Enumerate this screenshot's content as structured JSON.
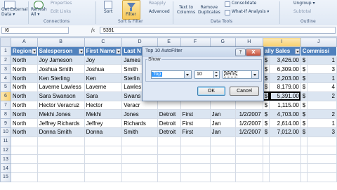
{
  "ribbon": {
    "buttons": {
      "from_external": [
        "Get External",
        "Data ▾"
      ],
      "refresh": [
        "Refresh",
        "All ▾"
      ],
      "properties": "Properties",
      "edit_links": "Edit Links",
      "sort": "Sort",
      "filter": "Filter",
      "reapply": "Reapply",
      "advanced": "Advanced",
      "text_to_columns": [
        "Text to",
        "Columns"
      ],
      "remove_duplicates": [
        "Remove",
        "Duplicates"
      ],
      "consolidate": "Consolidate",
      "what_if": "What-If Analysis ▾",
      "ungroup": "Ungroup ▾",
      "subtotal": "Subtotal"
    },
    "groups": {
      "connections": "Connections",
      "sort_filter": "Sort & Filter",
      "data_tools": "Data Tools",
      "outline": "Outline"
    }
  },
  "formula_bar": {
    "name_box": "I6",
    "fx": "fx",
    "value": "5391"
  },
  "grid": {
    "columns": [
      "A",
      "B",
      "C",
      "D",
      "E",
      "F",
      "G",
      "H",
      "I",
      "J"
    ],
    "selected_column": "I",
    "selected_row": "6",
    "header": [
      "Region",
      "Salesperson",
      "First Name",
      "Last N",
      "",
      "",
      "",
      "",
      "ally Sales",
      "Commissi"
    ],
    "rows": [
      {
        "n": "2",
        "cells": [
          "North",
          "Joy Jameson",
          "Joy",
          "James",
          "",
          "",
          "",
          "",
          "$",
          "3,426.00",
          "$",
          "1"
        ]
      },
      {
        "n": "3",
        "cells": [
          "North",
          "Joshua Smith",
          "Joshua",
          "Smith",
          "",
          "",
          "",
          "",
          "$",
          "6,309.00",
          "$",
          "3"
        ]
      },
      {
        "n": "4",
        "cells": [
          "North",
          "Ken Sterling",
          "Ken",
          "Sterlin",
          "",
          "",
          "",
          "",
          "$",
          "2,203.00",
          "$",
          "1"
        ]
      },
      {
        "n": "5",
        "cells": [
          "North",
          "Laverne Lawless",
          "Laverne",
          "Lawles",
          "",
          "",
          "",
          "",
          "$",
          "8,179.00",
          "$",
          "4"
        ]
      },
      {
        "n": "6",
        "cells": [
          "North",
          "Sara Swanson",
          "Sara",
          "Swans",
          "",
          "",
          "",
          "",
          "$",
          "5,391.00",
          "$",
          "2"
        ]
      },
      {
        "n": "7",
        "cells": [
          "North",
          "Hector Veracruz",
          "Hector",
          "Veracr",
          "",
          "",
          "",
          "",
          "$",
          "1,115.00",
          "$",
          ""
        ]
      },
      {
        "n": "8",
        "cells": [
          "North",
          "Mekhi Jones",
          "Mekhi",
          "Jones",
          "Detroit",
          "First",
          "Jan",
          "1/2/2007",
          "$",
          "4,703.00",
          "$",
          "2"
        ]
      },
      {
        "n": "9",
        "cells": [
          "North",
          "Jeffrey Richards",
          "Jeffrey",
          "Richards",
          "Detroit",
          "First",
          "Jan",
          "1/2/2007",
          "$",
          "2,614.00",
          "$",
          "1"
        ]
      },
      {
        "n": "10",
        "cells": [
          "North",
          "Donna Smith",
          "Donna",
          "Smith",
          "Detroit",
          "First",
          "Jan",
          "1/2/2007",
          "$",
          "7,012.00",
          "$",
          "3"
        ]
      },
      {
        "n": "11",
        "cells": [
          "",
          "",
          "",
          "",
          "",
          "",
          "",
          "",
          "",
          "",
          "",
          ""
        ]
      },
      {
        "n": "12",
        "cells": [
          "",
          "",
          "",
          "",
          "",
          "",
          "",
          "",
          "",
          "",
          "",
          ""
        ]
      },
      {
        "n": "13",
        "cells": [
          "",
          "",
          "",
          "",
          "",
          "",
          "",
          "",
          "",
          "",
          "",
          ""
        ]
      },
      {
        "n": "14",
        "cells": [
          "",
          "",
          "",
          "",
          "",
          "",
          "",
          "",
          "",
          "",
          "",
          ""
        ]
      },
      {
        "n": "15",
        "cells": [
          "",
          "",
          "",
          "",
          "",
          "",
          "",
          "",
          "",
          "",
          "",
          ""
        ]
      }
    ]
  },
  "dialog": {
    "title": "Top 10 AutoFilter",
    "help": "?",
    "close": "X",
    "group_label": "Show",
    "type_value": "Top",
    "count_value": "10",
    "unit_value": "Items",
    "ok": "OK",
    "cancel": "Cancel"
  },
  "colors": {
    "table_header": "#4f81bd",
    "band": "#dbe5f1",
    "selection_header": "#f8cf6c"
  }
}
